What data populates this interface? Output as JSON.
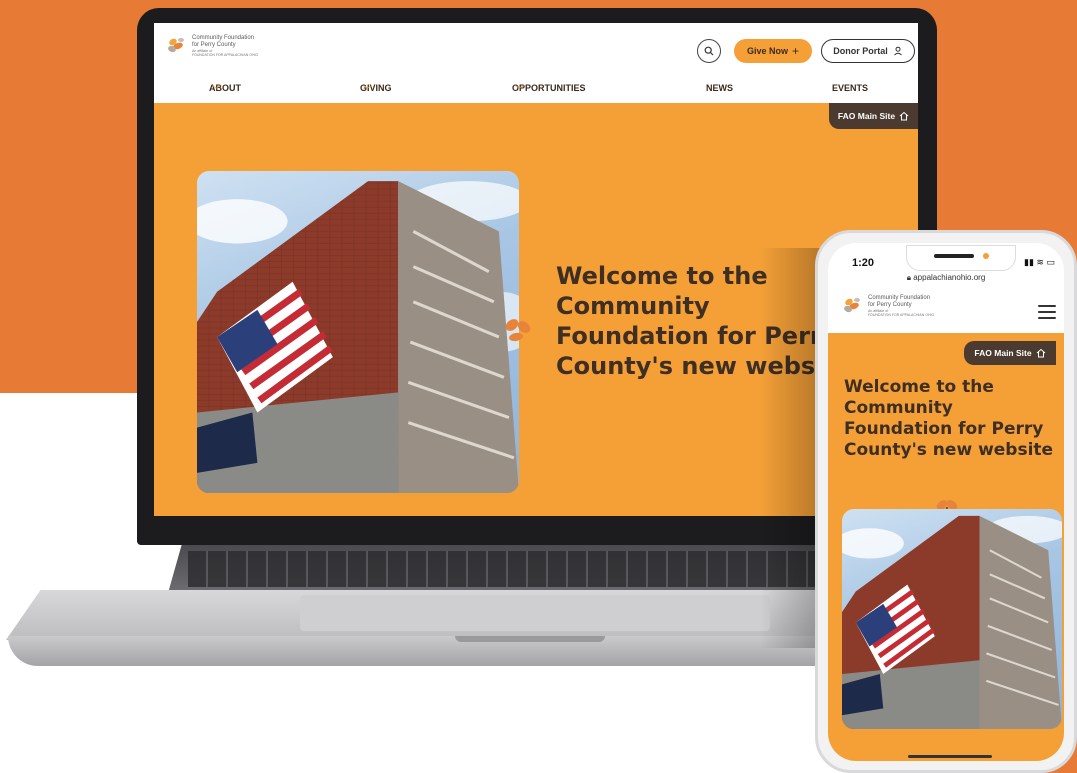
{
  "laptop_site": {
    "logo": {
      "line1": "Community Foundation",
      "line2": "for Perry County",
      "line3": "An affiliate of",
      "line4": "FOUNDATION FOR APPALACHIAN OHIO"
    },
    "search_icon": "search-icon",
    "give_now_label": "Give Now",
    "give_now_icon": "+",
    "donor_portal_label": "Donor Portal",
    "nav": [
      "ABOUT",
      "GIVING",
      "OPPORTUNITIES",
      "NEWS",
      "EVENTS"
    ],
    "fao_label": "FAO Main Site",
    "heading": "Welcome to the\nCommunity\nFoundation for Perry\nCounty's new website"
  },
  "phone_site": {
    "time": "1:20",
    "url": "appalachianohio.org",
    "logo": {
      "line1": "Community Foundation",
      "line2": "for Perry County",
      "line3": "An affiliate of",
      "line4": "FOUNDATION FOR APPALACHIAN OHIO"
    },
    "fao_label": "FAO Main Site",
    "heading": "Welcome to the\nCommunity\nFoundation for Perry\nCounty's new website"
  },
  "colors": {
    "brand_orange": "#f4a037",
    "background_orange": "#e77b35",
    "dark_brown": "#4a3a30",
    "heading_text": "#3e2e24"
  }
}
